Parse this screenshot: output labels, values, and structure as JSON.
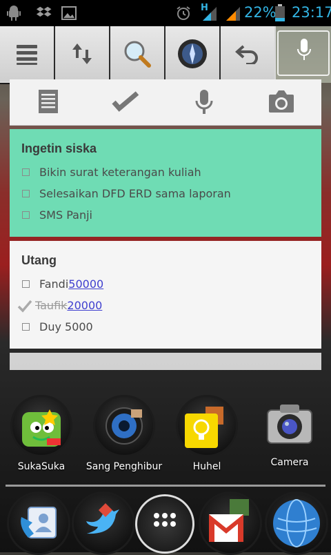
{
  "status_bar": {
    "network_type": "H",
    "battery_percent": "22%",
    "time": "23:17",
    "icons": [
      "android-icon",
      "dropbox-icon",
      "gallery-icon",
      "alarm-icon",
      "signal-icon",
      "signal-icon",
      "battery-icon"
    ]
  },
  "quick_bar": {
    "buttons": [
      "menu-icon",
      "data-sync-icon",
      "search-icon",
      "compass-icon",
      "back-icon"
    ],
    "mic_icon": "mic-icon"
  },
  "keep_toolbar": {
    "icons": [
      "new-note-icon",
      "checklist-icon",
      "voice-note-icon",
      "camera-icon"
    ]
  },
  "notes": [
    {
      "title": "Ingetin siska",
      "color": "#6fdcb4",
      "items": [
        {
          "text": "Bikin surat keterangan kuliah",
          "checked": false
        },
        {
          "text": "Selesaikan DFD ERD sama laporan",
          "checked": false
        },
        {
          "text": "SMS Panji",
          "checked": false
        }
      ]
    },
    {
      "title": "Utang",
      "color": "#f5f5f5",
      "items": [
        {
          "text": "Fandi ",
          "link": "50000",
          "checked": false
        },
        {
          "text": "Taufik ",
          "link": "20000",
          "checked": true
        },
        {
          "text": "Duy 5000",
          "checked": false
        }
      ]
    }
  ],
  "apps": [
    {
      "label": "SukaSuka",
      "icon": "game-folder-icon"
    },
    {
      "label": "Sang Penghibur",
      "icon": "music-folder-icon"
    },
    {
      "label": "Huhel",
      "icon": "keep-folder-icon"
    },
    {
      "label": "Camera",
      "icon": "camera-icon"
    }
  ],
  "dock": [
    "phone-contacts-icon",
    "twitter-folder-icon",
    "app-drawer-icon",
    "gmail-folder-icon",
    "browser-icon"
  ]
}
